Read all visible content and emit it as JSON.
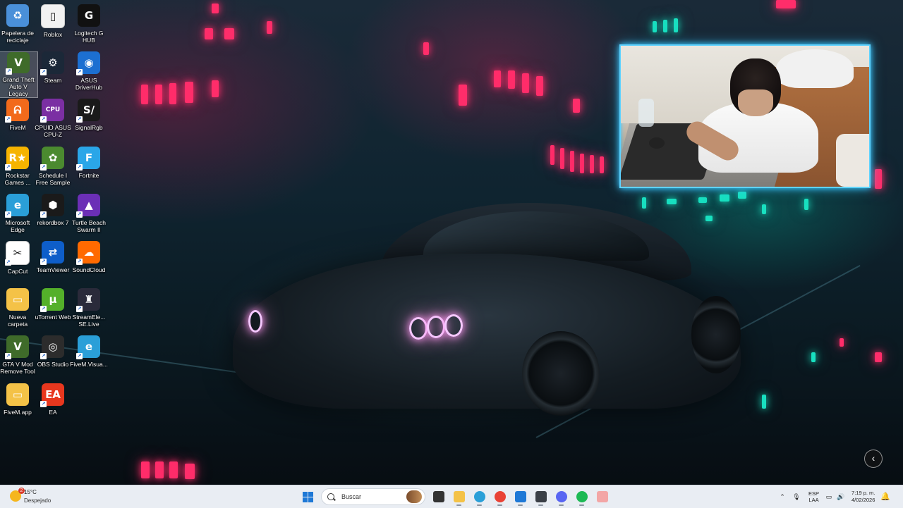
{
  "desktop": {
    "icons": [
      {
        "label": "Papelera de reciclaje",
        "icon": "recycle-bin-icon",
        "color": "#4a90d9"
      },
      {
        "label": "Roblox",
        "icon": "roblox-icon",
        "color": "#f2f2f2"
      },
      {
        "label": "Logitech G HUB",
        "icon": "logitech-g-hub-icon",
        "color": "#111111"
      },
      {
        "label": "Grand Theft Auto V Legacy",
        "icon": "gta-v-icon",
        "color": "#3f6b2a"
      },
      {
        "label": "Steam",
        "icon": "steam-icon",
        "color": "#1b2838"
      },
      {
        "label": "ASUS DriverHub",
        "icon": "asus-driverhub-icon",
        "color": "#1c6fd1"
      },
      {
        "label": "FiveM",
        "icon": "fivem-icon",
        "color": "#f26a1b"
      },
      {
        "label": "CPUID ASUS CPU-Z",
        "icon": "cpu-z-icon",
        "color": "#7b2fa3"
      },
      {
        "label": "SignalRgb",
        "icon": "signalrgb-icon",
        "color": "#1a1a1a"
      },
      {
        "label": "Rockstar Games ...",
        "icon": "rockstar-icon",
        "color": "#f6b400"
      },
      {
        "label": "Schedule I Free Sample",
        "icon": "schedule-i-icon",
        "color": "#4b8a2f"
      },
      {
        "label": "Fortnite",
        "icon": "fortnite-icon",
        "color": "#2aa6e8"
      },
      {
        "label": "Microsoft Edge",
        "icon": "edge-icon",
        "color": "#2a9fd8"
      },
      {
        "label": "rekordbox 7",
        "icon": "rekordbox-icon",
        "color": "#1a1a1a"
      },
      {
        "label": "Turtle Beach Swarm II",
        "icon": "turtle-beach-icon",
        "color": "#6b2fb6"
      },
      {
        "label": "CapCut",
        "icon": "capcut-icon",
        "color": "#ffffff"
      },
      {
        "label": "TeamViewer",
        "icon": "teamviewer-icon",
        "color": "#0e5ec9"
      },
      {
        "label": "SoundCloud",
        "icon": "soundcloud-icon",
        "color": "#ff6a00"
      },
      {
        "label": "Nueva carpeta",
        "icon": "folder-icon",
        "color": "#f4c247"
      },
      {
        "label": "uTorrent Web",
        "icon": "utorrent-icon",
        "color": "#54b02a"
      },
      {
        "label": "StreamEle... SE.Live",
        "icon": "streamelements-icon",
        "color": "#2a2a3a"
      },
      {
        "label": "GTA V Mod Remove Tool",
        "icon": "gta-mod-tool-icon",
        "color": "#3f6b2a"
      },
      {
        "label": "OBS Studio",
        "icon": "obs-icon",
        "color": "#2c2c2c"
      },
      {
        "label": "FiveM.Visua...",
        "icon": "edge-icon",
        "color": "#2a9fd8"
      },
      {
        "label": "FiveM.app",
        "icon": "folder-icon",
        "color": "#f4c247"
      },
      {
        "label": "EA",
        "icon": "ea-icon",
        "color": "#e8371e"
      }
    ],
    "glyphs": [
      "♻",
      "▯",
      "G",
      "V",
      "⚙",
      "◉",
      "ᕱ",
      "CPU",
      "S/",
      "R★",
      "✿",
      "F",
      "e",
      "⬢",
      "▲",
      "✂",
      "⇄",
      "☁",
      "▭",
      "µ",
      "♜",
      "V",
      "◎",
      "e",
      "▭",
      "EA"
    ]
  },
  "taskbar": {
    "weather": {
      "temp": "15°C",
      "condition": "Despejado",
      "badge": "2"
    },
    "search_placeholder": "Buscar",
    "apps": [
      {
        "name": "task-view-icon",
        "color": "#333333"
      },
      {
        "name": "file-explorer-icon",
        "color": "#f4c247"
      },
      {
        "name": "edge-taskbar-icon",
        "color": "#2a9fd8"
      },
      {
        "name": "chrome-icon",
        "color": "#e94235"
      },
      {
        "name": "store-icon",
        "color": "#1e78d6"
      },
      {
        "name": "app-cube-icon",
        "color": "#3a3f46"
      },
      {
        "name": "discord-icon",
        "color": "#5865f2"
      },
      {
        "name": "spotify-icon",
        "color": "#1db954"
      },
      {
        "name": "paint-icon",
        "color": "#f3a6a6"
      }
    ],
    "tray": {
      "language_line1": "ESP",
      "language_line2": "LAA",
      "time": "7:19 p. m.",
      "date": "4/02/2026"
    }
  },
  "nav": {
    "chevron": "‹"
  }
}
